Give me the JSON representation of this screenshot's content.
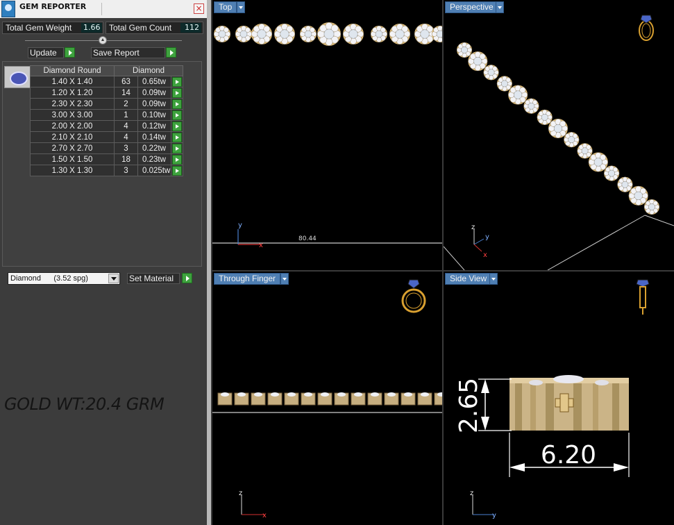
{
  "panel": {
    "title": "GEM REPORTER",
    "total_weight_label": "Total Gem Weight",
    "total_weight_value": "1.66",
    "total_count_label": "Total Gem Count",
    "total_count_value": "112",
    "update_label": "Update",
    "save_report_label": "Save Report",
    "table_headers": [
      "Diamond Round",
      "Diamond"
    ],
    "rows": [
      {
        "size": "1.40 X 1.40",
        "count": "63",
        "weight": "0.65tw"
      },
      {
        "size": "1.20 X 1.20",
        "count": "14",
        "weight": "0.09tw"
      },
      {
        "size": "2.30 X 2.30",
        "count": "2",
        "weight": "0.09tw"
      },
      {
        "size": "3.00 X 3.00",
        "count": "1",
        "weight": "0.10tw"
      },
      {
        "size": "2.00 X 2.00",
        "count": "4",
        "weight": "0.12tw"
      },
      {
        "size": "2.10 X 2.10",
        "count": "4",
        "weight": "0.14tw"
      },
      {
        "size": "2.70 X 2.70",
        "count": "3",
        "weight": "0.22tw"
      },
      {
        "size": "1.50 X 1.50",
        "count": "18",
        "weight": "0.23tw"
      },
      {
        "size": "1.30 X 1.30",
        "count": "3",
        "weight": "0.025tw"
      }
    ],
    "material_select": "Diamond      (3.52 spg)",
    "set_material_label": "Set Material",
    "gold_note": "GOLD WT:20.4 GRM"
  },
  "viewports": {
    "top": {
      "label": "Top",
      "measure": "80.44"
    },
    "perspective": {
      "label": "Perspective"
    },
    "through_finger": {
      "label": "Through Finger"
    },
    "side": {
      "label": "Side View",
      "height_dim": "2.65",
      "width_dim": "6.20"
    }
  },
  "colors": {
    "gold": "#d9b878",
    "viewport_label_bg": "#4f7fb3",
    "action_green": "#3ea23e"
  }
}
